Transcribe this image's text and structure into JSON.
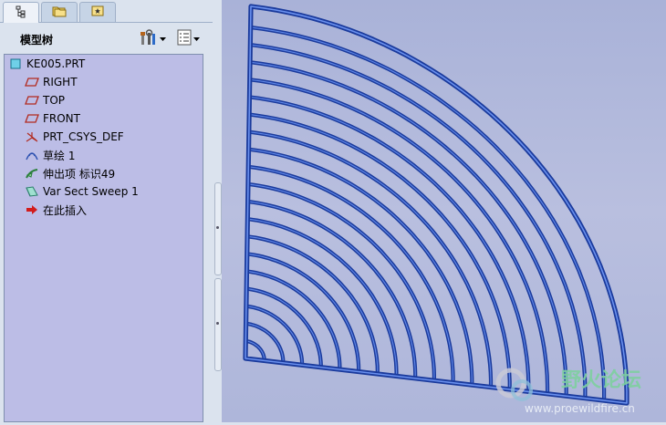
{
  "tabs": [
    {
      "name": "model-tree-tab",
      "icon": "tree-structure-icon"
    },
    {
      "name": "folder-browser-tab",
      "icon": "folder-icon"
    },
    {
      "name": "favorites-tab",
      "icon": "star-icon"
    }
  ],
  "panel": {
    "title": "模型树",
    "settings_icon": "tools-icon",
    "show_icon": "list-icon"
  },
  "tree": {
    "items": [
      {
        "label": "KE005.PRT",
        "icon": "part-icon"
      },
      {
        "label": "RIGHT",
        "icon": "datum-plane-icon"
      },
      {
        "label": "TOP",
        "icon": "datum-plane-icon"
      },
      {
        "label": "FRONT",
        "icon": "datum-plane-icon"
      },
      {
        "label": "PRT_CSYS_DEF",
        "icon": "coordinate-system-icon"
      },
      {
        "label": "草绘 1",
        "icon": "sketch-icon"
      },
      {
        "label": "伸出项 标识49",
        "icon": "protrusion-icon"
      },
      {
        "label": "Var Sect Sweep 1",
        "icon": "sweep-icon"
      },
      {
        "label": "在此插入",
        "icon": "insert-here-arrow-icon"
      }
    ]
  },
  "viewport": {
    "wire_color": "#1a3a9c",
    "background": "#b0b8dc"
  },
  "watermark": {
    "title": "野火论坛",
    "url": "www.proewildfire.cn"
  }
}
